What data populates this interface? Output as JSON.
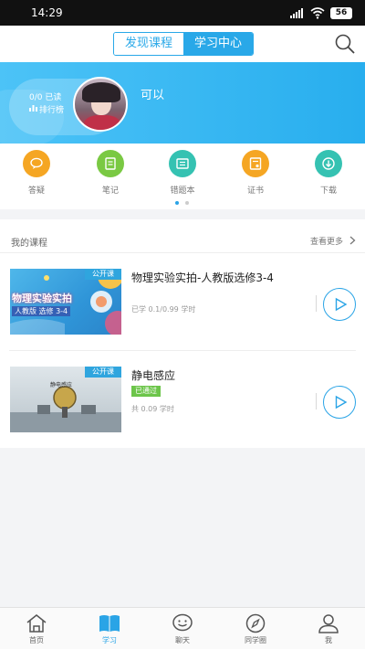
{
  "status_bar": {
    "time": "14:29",
    "battery": "56"
  },
  "header": {
    "tabs": [
      {
        "label": "发现课程",
        "active": false
      },
      {
        "label": "学习中心",
        "active": true
      }
    ],
    "search_icon": "search-icon"
  },
  "banner": {
    "rank_line1": "0/0 已读",
    "rank_line2": "排行榜",
    "username": "可以"
  },
  "quick_actions": [
    {
      "label": "答疑",
      "icon": "chat-bubble-icon",
      "color": "#f5a623"
    },
    {
      "label": "笔记",
      "icon": "notebook-icon",
      "color": "#7ac943"
    },
    {
      "label": "错题本",
      "icon": "error-book-icon",
      "color": "#35c2b2"
    },
    {
      "label": "证书",
      "icon": "certificate-icon",
      "color": "#f5a623"
    },
    {
      "label": "下载",
      "icon": "download-icon",
      "color": "#35c2b2"
    }
  ],
  "page_indicator": {
    "active_color": "#2aa4e6",
    "inactive_color": "#cccccc"
  },
  "my_courses": {
    "title": "我的课程",
    "more_label": "查看更多",
    "items": [
      {
        "title": "物理实验实拍-人教版选修3-4",
        "tag": "公开课",
        "badge": "",
        "progress": "已学 0.1/0.99 学时",
        "thumb_text": "物理实验实拍",
        "thumb_sub": "人教版 选修 3-4"
      },
      {
        "title": "静电感应",
        "tag": "公开课",
        "badge": "已通过",
        "progress": "共 0.09 学时",
        "thumb_text": "静电感应",
        "thumb_sub": ""
      }
    ]
  },
  "tab_bar": [
    {
      "label": "首页",
      "icon": "home-icon",
      "active": false
    },
    {
      "label": "学习",
      "icon": "book-icon",
      "active": true
    },
    {
      "label": "聊天",
      "icon": "smile-chat-icon",
      "active": false
    },
    {
      "label": "同学圈",
      "icon": "compass-icon",
      "active": false
    },
    {
      "label": "我",
      "icon": "person-icon",
      "active": false
    }
  ],
  "colors": {
    "accent": "#2aa4e6",
    "badge_green": "#6cc54a"
  }
}
